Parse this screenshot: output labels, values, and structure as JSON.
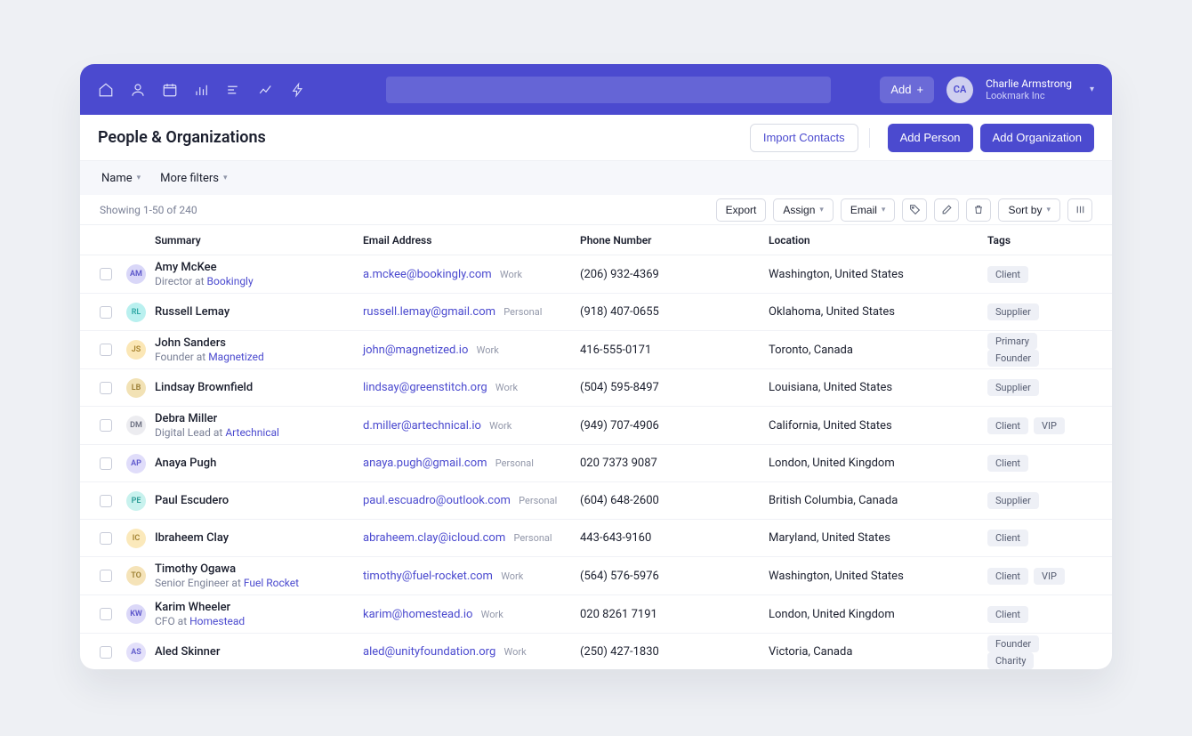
{
  "topbar": {
    "add_label": "Add",
    "user_initials": "CA",
    "user_name": "Charlie Armstrong",
    "user_org": "Lookmark Inc"
  },
  "subheader": {
    "title": "People & Organizations",
    "import": "Import Contacts",
    "add_person": "Add Person",
    "add_org": "Add Organization"
  },
  "filter": {
    "name": "Name",
    "more": "More filters"
  },
  "tools": {
    "count": "Showing 1-50 of 240",
    "export": "Export",
    "assign": "Assign",
    "email": "Email",
    "sort": "Sort by"
  },
  "columns": {
    "summary": "Summary",
    "email": "Email Address",
    "phone": "Phone Number",
    "location": "Location",
    "tags": "Tags"
  },
  "avatar_colors": [
    {
      "bg": "#d9d7f8",
      "fg": "#5a55c9"
    },
    {
      "bg": "#b9f0ef",
      "fg": "#2fa8a5"
    },
    {
      "bg": "#fbe7b6",
      "fg": "#a7822d"
    },
    {
      "bg": "#f2e2b5",
      "fg": "#9b7e34"
    },
    {
      "bg": "#ececf0",
      "fg": "#6b6f80"
    },
    {
      "bg": "#e0ddfa",
      "fg": "#5d57cc"
    },
    {
      "bg": "#c8f2ee",
      "fg": "#2e9e98"
    },
    {
      "bg": "#fbe9bb",
      "fg": "#a38230"
    },
    {
      "bg": "#f5e3b8",
      "fg": "#9d8033"
    },
    {
      "bg": "#dbd8f8",
      "fg": "#5b55ca"
    },
    {
      "bg": "#e3e0fa",
      "fg": "#5d58cb"
    }
  ],
  "rows": [
    {
      "initials": "AM",
      "name": "Amy McKee",
      "role": "Director at",
      "org": "Bookingly",
      "email": "a.mckee@bookingly.com",
      "email_label": "Work",
      "phone": "(206) 932-4369",
      "location": "Washington, United States",
      "tags": [
        "Client"
      ]
    },
    {
      "initials": "RL",
      "name": "Russell Lemay",
      "role": "",
      "org": "",
      "email": "russell.lemay@gmail.com",
      "email_label": "Personal",
      "phone": "(918) 407-0655",
      "location": "Oklahoma, United States",
      "tags": [
        "Supplier"
      ]
    },
    {
      "initials": "JS",
      "name": "John Sanders",
      "role": "Founder at",
      "org": "Magnetized",
      "email": "john@magnetized.io",
      "email_label": "Work",
      "phone": "416-555-0171",
      "location": "Toronto, Canada",
      "tags": [
        "Primary",
        "Founder"
      ]
    },
    {
      "initials": "LB",
      "name": "Lindsay Brownfield",
      "role": "",
      "org": "",
      "email": "lindsay@greenstitch.org",
      "email_label": "Work",
      "phone": "(504) 595-8497",
      "location": "Louisiana, United States",
      "tags": [
        "Supplier"
      ]
    },
    {
      "initials": "DM",
      "name": "Debra Miller",
      "role": "Digital Lead at",
      "org": "Artechnical",
      "email": "d.miller@artechnical.io",
      "email_label": "Work",
      "phone": "(949) 707-4906",
      "location": "California, United States",
      "tags": [
        "Client",
        "VIP"
      ]
    },
    {
      "initials": "AP",
      "name": "Anaya Pugh",
      "role": "",
      "org": "",
      "email": "anaya.pugh@gmail.com",
      "email_label": "Personal",
      "phone": "020 7373 9087",
      "location": "London, United Kingdom",
      "tags": [
        "Client"
      ]
    },
    {
      "initials": "PE",
      "name": "Paul Escudero",
      "role": "",
      "org": "",
      "email": "paul.escuadro@outlook.com",
      "email_label": "Personal",
      "phone": "(604) 648-2600",
      "location": "British Columbia, Canada",
      "tags": [
        "Supplier"
      ]
    },
    {
      "initials": "IC",
      "name": "Ibraheem Clay",
      "role": "",
      "org": "",
      "email": "abraheem.clay@icloud.com",
      "email_label": "Personal",
      "phone": "443-643-9160",
      "location": "Maryland, United States",
      "tags": [
        "Client"
      ]
    },
    {
      "initials": "TO",
      "name": "Timothy Ogawa",
      "role": "Senior Engineer at",
      "org": "Fuel Rocket",
      "email": "timothy@fuel-rocket.com",
      "email_label": "Work",
      "phone": "(564) 576-5976",
      "location": "Washington, United States",
      "tags": [
        "Client",
        "VIP"
      ]
    },
    {
      "initials": "KW",
      "name": "Karim Wheeler",
      "role": "CFO at",
      "org": "Homestead",
      "email": "karim@homestead.io",
      "email_label": "Work",
      "phone": "020 8261 7191",
      "location": "London, United Kingdom",
      "tags": [
        "Client"
      ]
    },
    {
      "initials": "AS",
      "name": "Aled Skinner",
      "role": "",
      "org": "",
      "email": "aled@unityfoundation.org",
      "email_label": "Work",
      "phone": "(250) 427-1830",
      "location": "Victoria, Canada",
      "tags": [
        "Founder",
        "Charity"
      ]
    }
  ]
}
